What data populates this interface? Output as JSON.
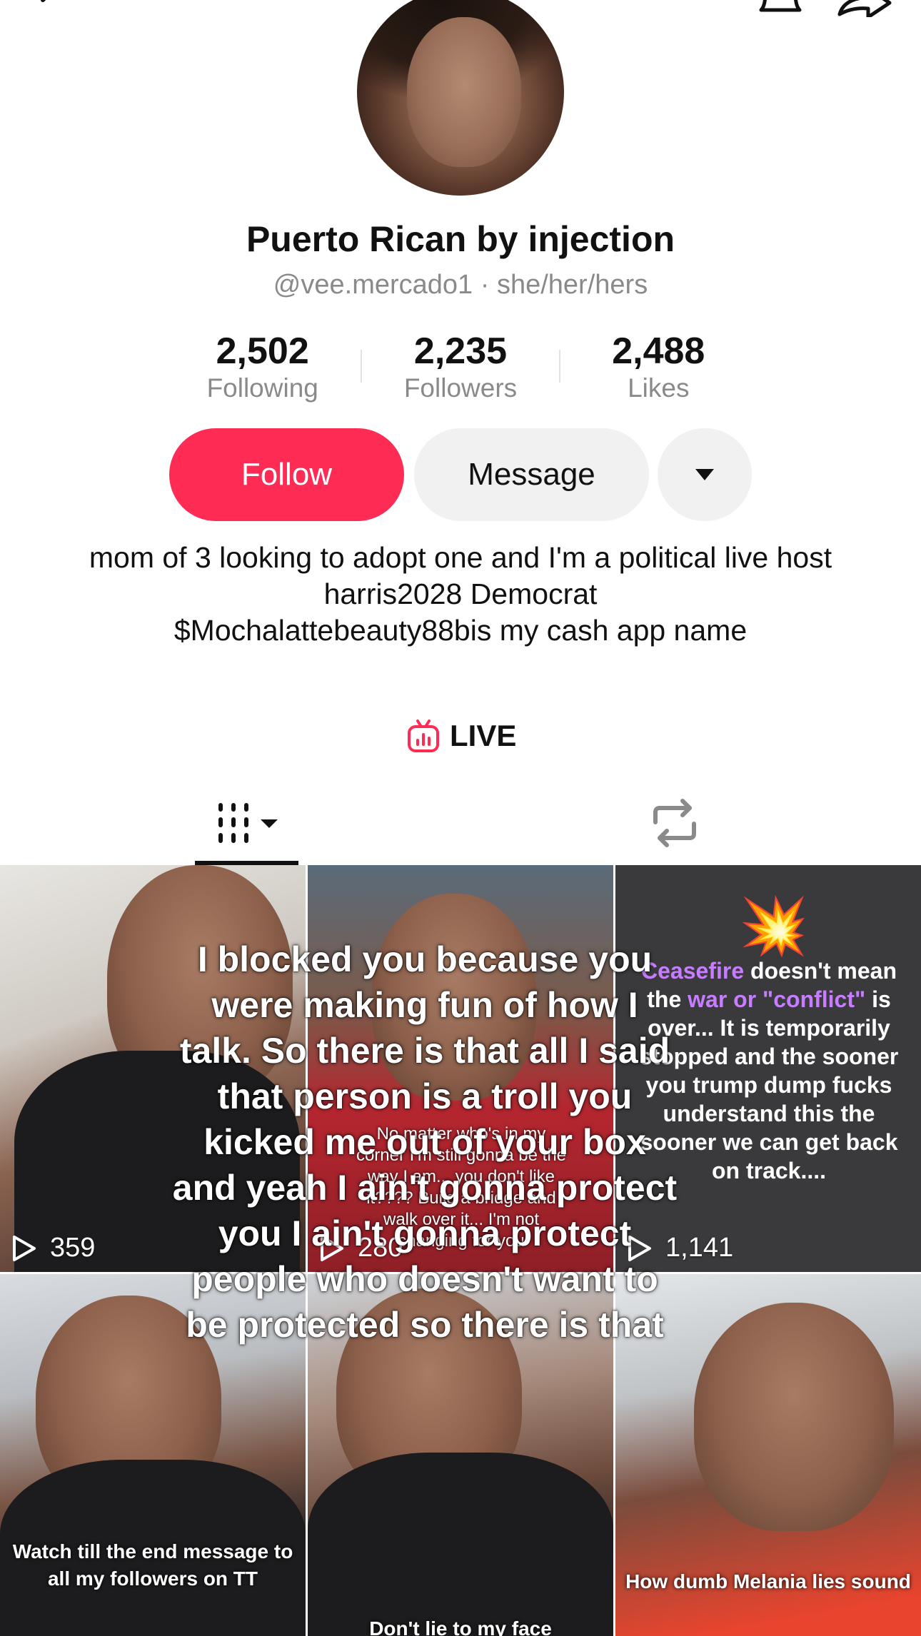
{
  "profile": {
    "display_name": "Puerto Rican by injection",
    "handle": "@vee.mercado1",
    "pronouns": "she/her/hers",
    "separator": "·"
  },
  "stats": [
    {
      "value": "2,502",
      "label": "Following"
    },
    {
      "value": "2,235",
      "label": "Followers"
    },
    {
      "value": "2,488",
      "label": "Likes"
    }
  ],
  "actions": {
    "follow_label": "Follow",
    "message_label": "Message",
    "accent_color": "#fe2c55"
  },
  "bio": {
    "line1": "mom of 3 looking to adopt one and I'm a political live host",
    "line2": "harris2028 Democrat",
    "line3": "$Mochalattebeauty88bis my cash app name"
  },
  "live": {
    "label": "LIVE",
    "icon": "live-tv-icon",
    "color": "#fe2c55"
  },
  "tabs": [
    {
      "icon": "video-grid-icon",
      "selected": true
    },
    {
      "icon": "repost-icon",
      "selected": false
    }
  ],
  "videos": [
    {
      "views": "359",
      "caption": ""
    },
    {
      "views": "280",
      "caption": "No matter who's in my corner I'm still gonna be the way I am... you don't like it???? Build a bridge and walk over it... I'm not changing for you"
    },
    {
      "views": "1,141",
      "caption_parts": [
        "Ceasefire",
        " doesn't mean the ",
        "war or \"conflict\"",
        " is over... It is temporarily stopped and the sooner you trump dump fucks understand this the sooner we can get back on track...."
      ]
    },
    {
      "views": "",
      "caption": "Watch till the end message to all my followers on TT"
    },
    {
      "views": "",
      "caption": "Don't lie to my face"
    },
    {
      "views": "",
      "caption": "How dumb Melania lies sound"
    }
  ],
  "overlay_text": "I blocked you because you were  making fun of how I talk. So there is that all I said that person is a troll you kicked me out of your box and  yeah I ain't gonna protect you I ain't gonna protect people who doesn't want to be protected so there is that"
}
